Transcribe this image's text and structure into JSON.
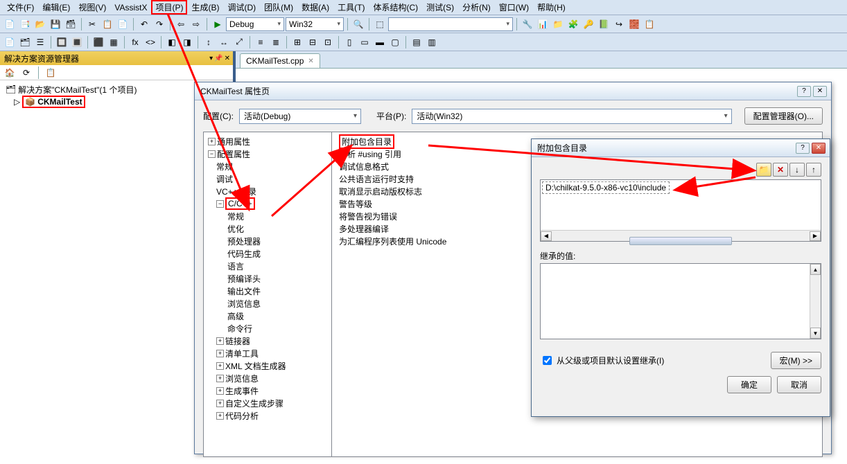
{
  "menu": [
    "文件(F)",
    "编辑(E)",
    "视图(V)",
    "VAssistX",
    "项目(P)",
    "生成(B)",
    "调试(D)",
    "团队(M)",
    "数据(A)",
    "工具(T)",
    "体系结构(C)",
    "测试(S)",
    "分析(N)",
    "窗口(W)",
    "帮助(H)"
  ],
  "toolbar_combos": {
    "config": "Debug",
    "platform": "Win32"
  },
  "solution_explorer": {
    "title": "解决方案资源管理器",
    "solution_line": "解决方案\"CKMailTest\"(1 个项目)",
    "project": "CKMailTest"
  },
  "doc_tab": "CKMailTest.cpp",
  "propdlg": {
    "title": "CKMailTest 属性页",
    "config_label": "配置(C):",
    "config_value": "活动(Debug)",
    "platform_label": "平台(P):",
    "platform_value": "活动(Win32)",
    "config_mgr": "配置管理器(O)...",
    "tree": {
      "common": "通用属性",
      "config_props": "配置属性",
      "general": "常规",
      "debug": "调试",
      "vcpp": "VC++ 目录",
      "ccpp": "C/C++",
      "sub": [
        "常规",
        "优化",
        "预处理器",
        "代码生成",
        "语言",
        "预编译头",
        "输出文件",
        "浏览信息",
        "高级",
        "命令行"
      ],
      "linker": "链接器",
      "manifest": "清单工具",
      "xml": "XML 文档生成器",
      "browse": "浏览信息",
      "build": "生成事件",
      "custom": "自定义生成步骤",
      "codeanalysis": "代码分析"
    },
    "list": [
      "附加包含目录",
      "解析 #using 引用",
      "调试信息格式",
      "公共语言运行时支持",
      "取消显示启动版权标志",
      "警告等级",
      "将警告视为错误",
      "多处理器编译",
      "为汇编程序列表使用 Unicode"
    ]
  },
  "incdlg": {
    "title": "附加包含目录",
    "path": "D:\\chilkat-9.5.0-x86-vc10\\include",
    "inherit_label": "继承的值:",
    "inherit_check": "从父级或项目默认设置继承(I)",
    "macro_btn": "宏(M) >>",
    "ok": "确定",
    "cancel": "取消"
  }
}
